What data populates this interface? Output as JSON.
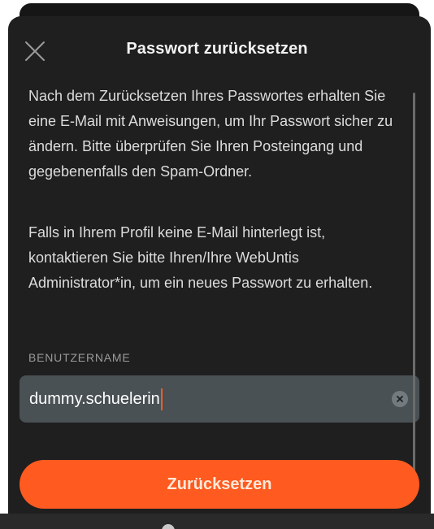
{
  "dialog": {
    "title": "Passwort zurücksetzen",
    "close_icon": "close-icon",
    "paragraphs": [
      "Nach dem Zurücksetzen Ihres Passwortes erhalten Sie eine E-Mail mit Anweisungen, um Ihr Passwort sicher zu ändern. Bitte überprüfen Sie Ihren Posteingang und gegebenenfalls den Spam-Ordner.",
      "Falls in Ihrem Profil keine E-Mail hinterlegt ist, kontaktieren Sie bitte Ihren/Ihre WebUntis Administrator*in, um ein neues Passwort zu erhalten."
    ],
    "username_field": {
      "label": "BENUTZERNAME",
      "value": "dummy.schuelerin",
      "clear_icon": "clear-icon"
    },
    "reset_button": {
      "label": "Zurücksetzen"
    }
  },
  "colors": {
    "accent": "#ff5a1f",
    "sheet_background": "#1f1f1f",
    "input_background": "#4a5155"
  }
}
